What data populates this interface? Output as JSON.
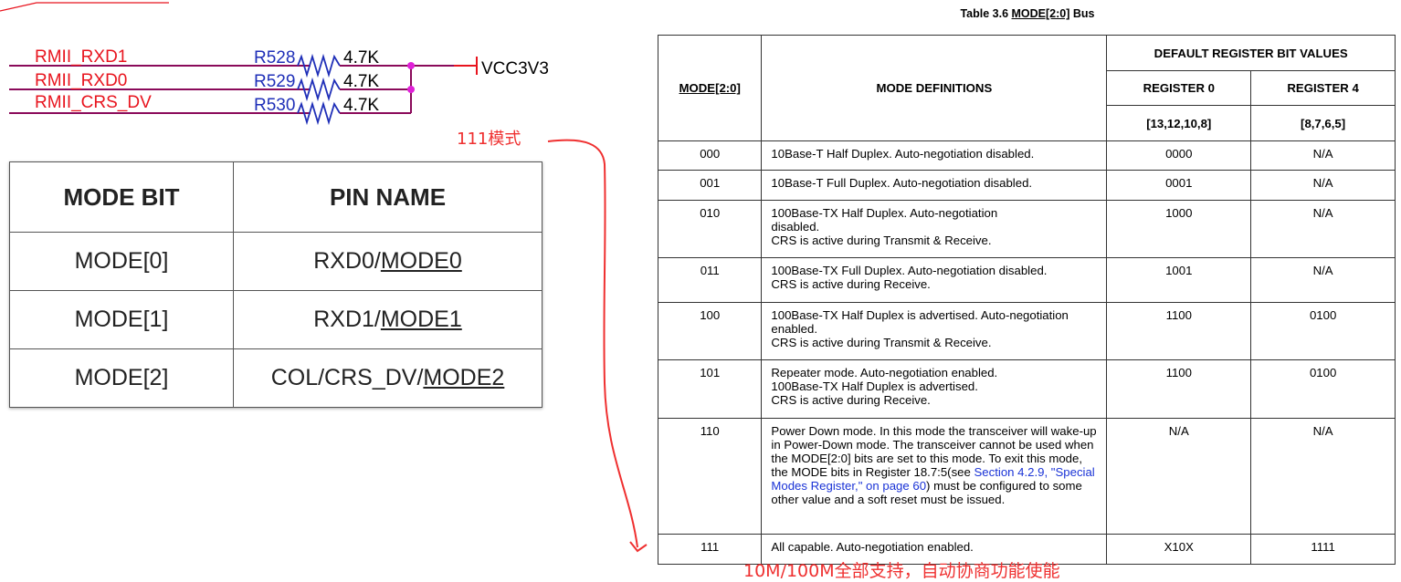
{
  "schematic": {
    "nets": [
      "RMII_RXD1",
      "RMII_RXD0",
      "RMII_CRS_DV"
    ],
    "resistors": [
      {
        "ref": "R528",
        "value": "4.7K"
      },
      {
        "ref": "R529",
        "value": "4.7K"
      },
      {
        "ref": "R530",
        "value": "4.7K"
      }
    ],
    "power": "VCC3V3"
  },
  "mode_table": {
    "headers": [
      "MODE BIT",
      "PIN NAME"
    ],
    "rows": [
      {
        "bit": "MODE[0]",
        "pin_prefix": "RXD0/",
        "pin_mode": "MODE0"
      },
      {
        "bit": "MODE[1]",
        "pin_prefix": "RXD1/",
        "pin_mode": "MODE1"
      },
      {
        "bit": "MODE[2]",
        "pin_prefix": "COL/CRS_DV/",
        "pin_mode": "MODE2"
      }
    ]
  },
  "bus_table": {
    "caption_prefix": "Table 3.6  ",
    "caption_u": "MODE[2:0]",
    "caption_suffix": " Bus",
    "headers": {
      "mode": "MODE[2:0]",
      "definitions": "MODE DEFINITIONS",
      "default_values": "DEFAULT REGISTER BIT VALUES",
      "reg0": "REGISTER 0",
      "reg4": "REGISTER 4",
      "reg0_bits": "[13,12,10,8]",
      "reg4_bits": "[8,7,6,5]"
    },
    "rows": [
      {
        "mode": "000",
        "def": "10Base-T Half Duplex. Auto-negotiation disabled.",
        "r0": "0000",
        "r4": "N/A"
      },
      {
        "mode": "001",
        "def": "10Base-T Full Duplex. Auto-negotiation disabled.",
        "r0": "0001",
        "r4": "N/A"
      },
      {
        "mode": "010",
        "def": "100Base-TX Half Duplex. Auto-negotiation disabled.\nCRS is active during Transmit & Receive.",
        "r0": "1000",
        "r4": "N/A"
      },
      {
        "mode": "011",
        "def": "100Base-TX Full Duplex. Auto-negotiation disabled.\nCRS is active during Receive.",
        "r0": "1001",
        "r4": "N/A"
      },
      {
        "mode": "100",
        "def": "100Base-TX Half Duplex is advertised. Auto-negotiation enabled.\nCRS is active during Transmit & Receive.",
        "r0": "1100",
        "r4": "0100"
      },
      {
        "mode": "101",
        "def": "Repeater mode. Auto-negotiation enabled.\n100Base-TX Half Duplex is advertised.\nCRS is active during Receive.",
        "r0": "1100",
        "r4": "0100"
      },
      {
        "mode": "110",
        "def_a": "Power Down mode. In this mode the transceiver will wake-up in Power-Down mode. The transceiver cannot be used when the MODE[2:0] bits are set to this mode. To exit this mode, the MODE bits in Register 18.7:5(see ",
        "def_link": "Section 4.2.9, \"Special Modes Register,\" on page 60",
        "def_b": ") must be configured to some other value and a soft reset must be issued.",
        "r0": "N/A",
        "r4": "N/A"
      },
      {
        "mode": "111",
        "def": "All capable. Auto-negotiation enabled.",
        "r0": "X10X",
        "r4": "1111"
      }
    ]
  },
  "annotations": {
    "mode_111": "111模式",
    "bottom_note": "10M/100M全部支持，自动协商功能使能"
  },
  "colors": {
    "net_red": "#e8141e",
    "ref_blue": "#1f2fb8",
    "junction_magenta": "#e020d8",
    "annotation_red": "#ef3030",
    "link_blue": "#1a33d6"
  }
}
